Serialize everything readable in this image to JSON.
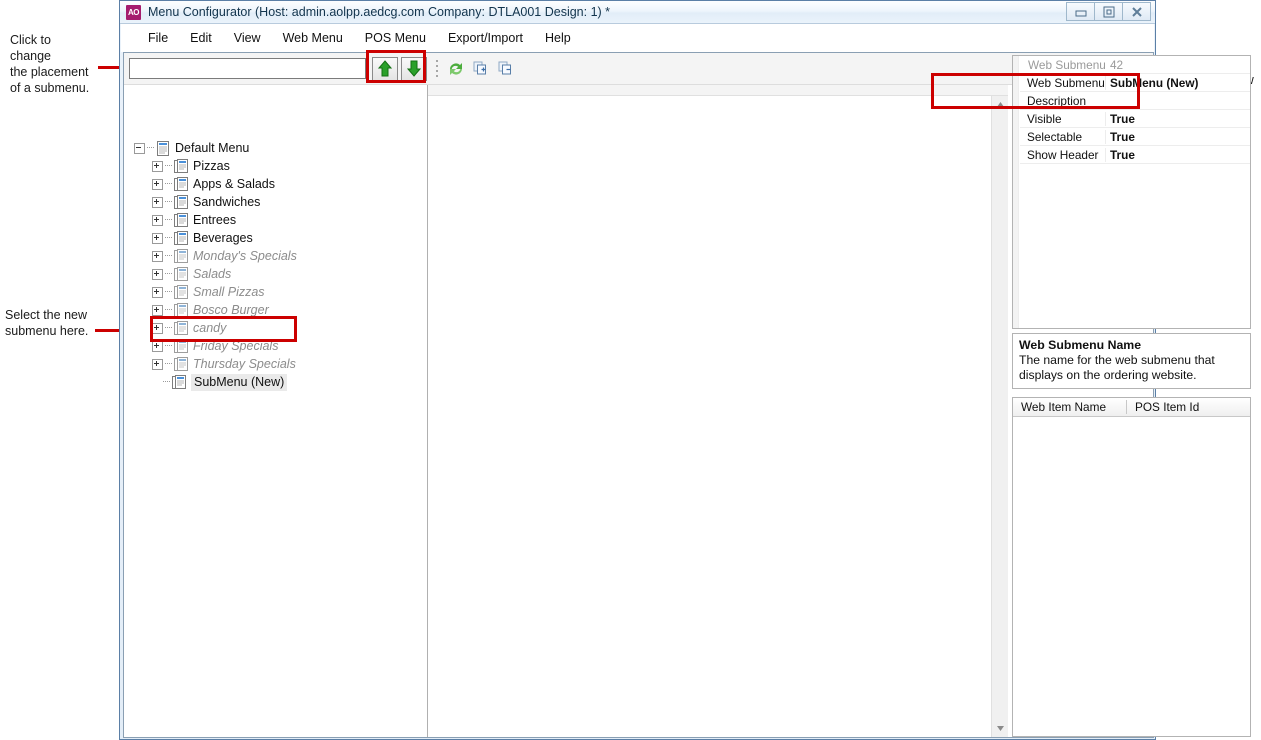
{
  "window": {
    "app_icon_text": "AO",
    "title": "Menu Configurator  (Host: admin.aolpp.aedcg.com   Company: DTLA001   Design: 1) *",
    "buttons": {
      "minimize": "minimize-icon",
      "restore": "restore-icon",
      "close": "close-icon"
    }
  },
  "menubar": {
    "items": [
      {
        "label": "File"
      },
      {
        "label": "Edit"
      },
      {
        "label": "View"
      },
      {
        "label": "Web Menu"
      },
      {
        "label": "POS Menu"
      },
      {
        "label": "Export/Import"
      },
      {
        "label": "Help"
      }
    ]
  },
  "toolbar": {
    "search_value": "",
    "search_placeholder": "",
    "move_up_label": "Move Up",
    "move_down_label": "Move Down",
    "icons": [
      {
        "name": "refresh-icon"
      },
      {
        "name": "copy-add-icon"
      },
      {
        "name": "copy-remove-icon"
      }
    ]
  },
  "tree": {
    "nodes": [
      {
        "label": "Default Menu",
        "level": 1,
        "state": "expanded",
        "disabled": false,
        "selected": false
      },
      {
        "label": "Pizzas",
        "level": 2,
        "state": "collapsed",
        "disabled": false,
        "selected": false
      },
      {
        "label": "Apps & Salads",
        "level": 2,
        "state": "collapsed",
        "disabled": false,
        "selected": false
      },
      {
        "label": "Sandwiches",
        "level": 2,
        "state": "collapsed",
        "disabled": false,
        "selected": false
      },
      {
        "label": "Entrees",
        "level": 2,
        "state": "collapsed",
        "disabled": false,
        "selected": false
      },
      {
        "label": "Beverages",
        "level": 2,
        "state": "collapsed",
        "disabled": false,
        "selected": false
      },
      {
        "label": "Monday's Specials",
        "level": 2,
        "state": "collapsed",
        "disabled": true,
        "selected": false
      },
      {
        "label": "Salads",
        "level": 2,
        "state": "collapsed",
        "disabled": true,
        "selected": false
      },
      {
        "label": "Small Pizzas",
        "level": 2,
        "state": "collapsed",
        "disabled": true,
        "selected": false
      },
      {
        "label": "Bosco Burger",
        "level": 2,
        "state": "collapsed",
        "disabled": true,
        "selected": false
      },
      {
        "label": "candy",
        "level": 2,
        "state": "collapsed",
        "disabled": true,
        "selected": false
      },
      {
        "label": "Friday Specials",
        "level": 2,
        "state": "collapsed",
        "disabled": true,
        "selected": false
      },
      {
        "label": "Thursday Specials",
        "level": 2,
        "state": "collapsed",
        "disabled": true,
        "selected": false
      },
      {
        "label": "SubMenu (New)",
        "level": 2,
        "state": "leaf",
        "disabled": false,
        "selected": true
      }
    ]
  },
  "properties": {
    "rows": [
      {
        "name": "Web Submenu",
        "value": "42",
        "muted": true
      },
      {
        "name": "Web Submenu",
        "value": "SubMenu (New)",
        "muted": false
      },
      {
        "name": "Description",
        "value": "",
        "muted": false
      },
      {
        "name": "Visible",
        "value": "True",
        "muted": false
      },
      {
        "name": "Selectable",
        "value": "True",
        "muted": false
      },
      {
        "name": "Show Header",
        "value": "True",
        "muted": false
      }
    ]
  },
  "property_help": {
    "title": "Web Submenu Name",
    "body": "The name for the web submenu that displays on the ordering website."
  },
  "item_grid": {
    "columns": [
      "Web Item Name",
      "POS Item Id"
    ],
    "rows": []
  },
  "annotations": [
    {
      "id": "annotation-placement",
      "text": "Click to\nchange\nthe placement\nof a submenu."
    },
    {
      "id": "annotation-select-submenu",
      "text": "Select the new\nsubmenu here."
    },
    {
      "id": "annotation-edit-name",
      "text": "Edit the new\nsub menu\nname."
    }
  ],
  "colors": {
    "highlight": "#cc0000",
    "title_bar_accent": "#a51c6e",
    "arrow_green": "#2aa02a"
  }
}
